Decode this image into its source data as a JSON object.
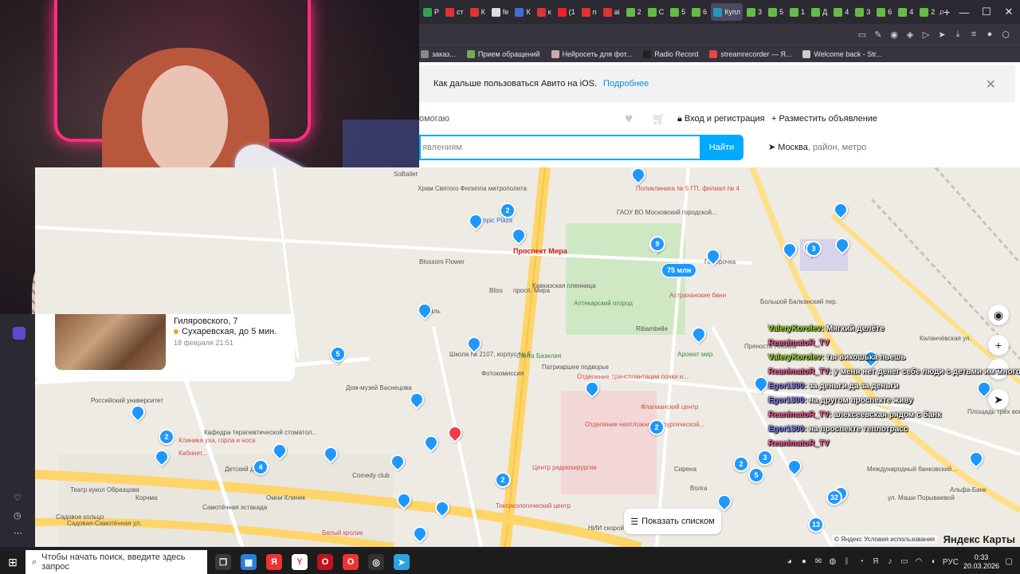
{
  "browser": {
    "tabs": [
      {
        "label": "Р",
        "color": "#2da44e"
      },
      {
        "label": "ст",
        "color": "#d33"
      },
      {
        "label": "К",
        "color": "#d33"
      },
      {
        "label": "fe",
        "color": "#ddd"
      },
      {
        "label": "К",
        "color": "#3b6fd8"
      },
      {
        "label": "к",
        "color": "#d33"
      },
      {
        "label": "(1",
        "color": "#e22"
      },
      {
        "label": "n",
        "color": "#d33"
      },
      {
        "label": "ai",
        "color": "#d33"
      },
      {
        "label": "2",
        "color": "#6b4"
      },
      {
        "label": "С",
        "color": "#6b4"
      },
      {
        "label": "5",
        "color": "#6b4"
      },
      {
        "label": "6",
        "color": "#6b4"
      },
      {
        "label": "Купл",
        "color": "#29b",
        "active": true
      },
      {
        "label": "3",
        "color": "#6b4"
      },
      {
        "label": "5",
        "color": "#6b4"
      },
      {
        "label": "1",
        "color": "#6b4"
      },
      {
        "label": "Д",
        "color": "#6b4"
      },
      {
        "label": "4",
        "color": "#6b4"
      },
      {
        "label": "3",
        "color": "#6b4"
      },
      {
        "label": "6",
        "color": "#6b4"
      },
      {
        "label": "4",
        "color": "#6b4"
      },
      {
        "label": "2",
        "color": "#6b4"
      }
    ],
    "new_tab": "+",
    "bookmarks": [
      {
        "label": "заказ...",
        "color": "#888"
      },
      {
        "label": "Прием обращений",
        "color": "#7a5"
      },
      {
        "label": "Нейросеть для фот...",
        "color": "#caa"
      },
      {
        "label": "Radio Record",
        "color": "#222"
      },
      {
        "label": "streamrecorder — Я...",
        "color": "#e44"
      },
      {
        "label": "Welcome back - Str...",
        "color": "#ccc"
      }
    ]
  },
  "avito": {
    "ios_banner": {
      "text": "Как дальше пользоваться Авито на iOS.",
      "link": "Подробнее",
      "close": "✕"
    },
    "header": {
      "help": "омогаю",
      "login": "Вход и регистрация",
      "post_ad": "Разместить объявление"
    },
    "search": {
      "placeholder": "явлениям",
      "button": "Найти"
    },
    "location": {
      "city": "Москва",
      "hint": ", район, метро"
    }
  },
  "card": {
    "address": "Гиляровского, 7",
    "metro": "Сухаревская, до 5 мин.",
    "date": "18 февраля 21:51"
  },
  "map": {
    "show_list": "Показать списком",
    "price_tag": "75 млн",
    "copyright": "© Яндекс Условия использования",
    "logo": "Яндекс Карты",
    "labels": [
      "SoBallet",
      "Храм Святого Филиппа митрополита",
      "Поликлиника № 5 ГП, филиал № 4",
      "ГАОУ ВО Московский городской...",
      "Проспект Мира",
      "Olympic Plaza",
      "Кавказская пленница",
      "Аптекарский огород",
      "Ribambelle",
      "Пятёрочка",
      "Астраханские бани",
      "Большой Балканский пер.",
      "Bliss",
      "Blossom Flower",
      "Хакаль",
      "Школа № 2107, корпус № 6",
      "Санта Базилия",
      "Патриаршее подворье",
      "Фотокомиссия",
      "Дом-музей Васнецова",
      "Российский университет",
      "Кафедра терапевтической стоматол...",
      "Отделение трансплантации почки и...",
      "Отделение неотложной хирургической...",
      "Центр радиохирургии",
      "Флагманский центр",
      "Кабинет...",
      "Детский дом",
      "Comedy club",
      "Омни Клиник",
      "Театр кукол Образцова",
      "Корчма",
      "Самотёчная эстакада",
      "Садовое кольцо",
      "Садовая-Самотёчная ул.",
      "Токсикологический центр",
      "Белый кролик",
      "НИИ скорой помощи им. Н. В...",
      "Сирена",
      "Волга",
      "Международный банковский...",
      "Альфа-Банк",
      "Площадь трёх вокзалов",
      "Аромат мир",
      "просп. Мира",
      "Клиника уха, горла и носа",
      "Пряности Японии",
      "ул. Маши Порываевой",
      "Каланчёвская ул."
    ],
    "clusters": [
      "2",
      "9",
      "3",
      "5",
      "2",
      "4",
      "2",
      "2",
      "2",
      "5",
      "3",
      "32",
      "13"
    ]
  },
  "sidebar": {
    "icons": [
      "heart-icon",
      "clock-icon",
      "more-icon"
    ]
  },
  "chat": [
    {
      "user": "ValeryKorolev",
      "msg": ": Мягкий делёте",
      "color": "#9fe31f"
    },
    {
      "user": "ReanimatoR_TV",
      "msg": "",
      "color": "#ff5fa0"
    },
    {
      "user": "ValeryKorolev",
      "msg": ": ты викошька пьешь",
      "color": "#9fe31f"
    },
    {
      "user": "ReanimatoR_TV",
      "msg": ": у меня нет денег себе люди с детьми им много",
      "color": "#ff5fa0"
    },
    {
      "user": "Egor1300",
      "msg": ": за деньги да за деньги",
      "color": "#8888ff"
    },
    {
      "user": "Egor1300",
      "msg": ": на другом проспекте живу",
      "color": "#8888ff"
    },
    {
      "user": "ReanimatoR_TV",
      "msg": ": алексеевская рядом с банк",
      "color": "#ff5fa0"
    },
    {
      "user": "Egor1300",
      "msg": ": на проспекте теплотрасс",
      "color": "#8888ff"
    },
    {
      "user": "ReanimatoR_TV",
      "msg": "",
      "color": "#ff5fa0"
    }
  ],
  "taskbar": {
    "search_placeholder": "Чтобы начать поиск, введите здесь запрос",
    "lang": "РУС",
    "time": "0:33",
    "date": "20.03.2026"
  }
}
